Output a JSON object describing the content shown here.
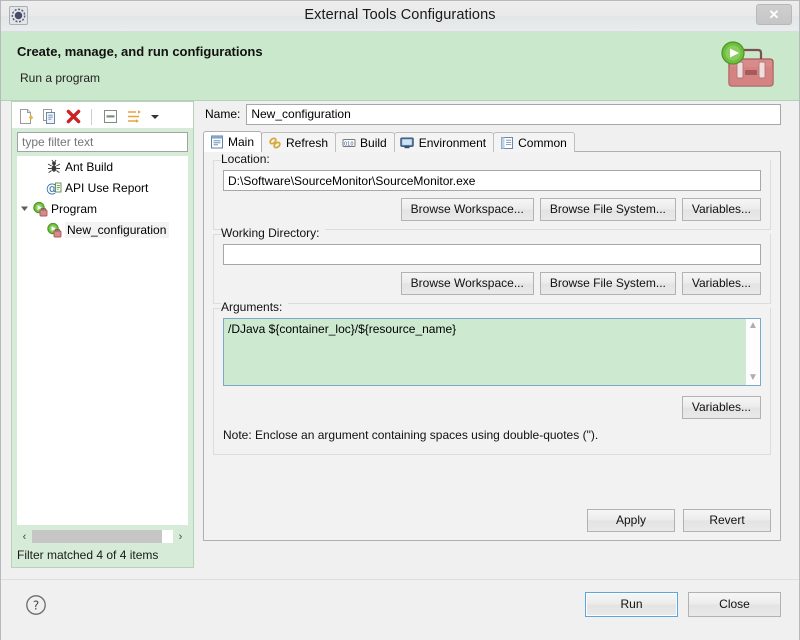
{
  "window": {
    "title": "External Tools Configurations",
    "app_icon": "gear-icon",
    "close_label": "✕"
  },
  "banner": {
    "title": "Create, manage, and run configurations",
    "subtitle": "Run a program",
    "art_icon": "toolbox-run-icon",
    "bg_color": "#cae8cb"
  },
  "left_panel": {
    "toolbar": [
      {
        "name": "new-configuration-icon",
        "tooltip": "New launch configuration"
      },
      {
        "name": "duplicate-configuration-icon",
        "tooltip": "Duplicate"
      },
      {
        "name": "delete-configuration-icon",
        "tooltip": "Delete"
      },
      {
        "name": "collapse-all-icon",
        "tooltip": "Collapse All"
      },
      {
        "name": "filter-icon",
        "tooltip": "Filter"
      },
      {
        "name": "chevron-down-icon",
        "tooltip": "Menu"
      }
    ],
    "filter": {
      "value": "",
      "placeholder": "type filter text"
    },
    "tree": [
      {
        "label": "Ant Build",
        "icon": "ant-build-icon",
        "indent": 0,
        "twisty": "",
        "selected": false
      },
      {
        "label": "API Use Report",
        "icon": "api-use-report-icon",
        "indent": 0,
        "twisty": "",
        "selected": false
      },
      {
        "label": "Program",
        "icon": "program-icon",
        "indent": 0,
        "twisty": "▼",
        "selected": false
      },
      {
        "label": "New_configuration",
        "icon": "program-config-icon",
        "indent": 1,
        "twisty": "",
        "selected": true
      }
    ],
    "status": "Filter matched 4 of 4 items",
    "hscroll_left": "‹",
    "hscroll_right": "›"
  },
  "right_panel": {
    "name": {
      "label": "Name:",
      "value": "New_configuration",
      "placeholder": ""
    },
    "tabs": [
      {
        "label": "Main",
        "icon": "main-tab-icon",
        "active": true
      },
      {
        "label": "Refresh",
        "icon": "refresh-tab-icon",
        "active": false
      },
      {
        "label": "Build",
        "icon": "build-tab-icon",
        "active": false
      },
      {
        "label": "Environment",
        "icon": "environment-tab-icon",
        "active": false
      },
      {
        "label": "Common",
        "icon": "common-tab-icon",
        "active": false
      }
    ],
    "location": {
      "label": "Location:",
      "value": "D:\\Software\\SourceMonitor\\SourceMonitor.exe",
      "placeholder": "",
      "buttons": [
        "Browse Workspace...",
        "Browse File System...",
        "Variables..."
      ]
    },
    "working_directory": {
      "label": "Working Directory:",
      "value": "",
      "placeholder": "",
      "buttons": [
        "Browse Workspace...",
        "Browse File System...",
        "Variables..."
      ]
    },
    "arguments": {
      "label": "Arguments:",
      "value": "/DJava ${container_loc}/${resource_name}",
      "placeholder": "",
      "button": "Variables...",
      "note": "Note: Enclose an argument containing spaces using double-quotes (\").",
      "scroll_up": "▲",
      "scroll_down": "▼"
    },
    "apply_label": "Apply",
    "revert_label": "Revert"
  },
  "footer": {
    "help_icon": "help-question-icon",
    "run_label": "Run",
    "close_label": "Close"
  },
  "colors": {
    "banner_green": "#cae8cb",
    "panel_green": "#d7ecd8",
    "args_green": "#cde9cf",
    "focus_blue": "#5ba7dd",
    "delete_red": "#cc2222"
  }
}
